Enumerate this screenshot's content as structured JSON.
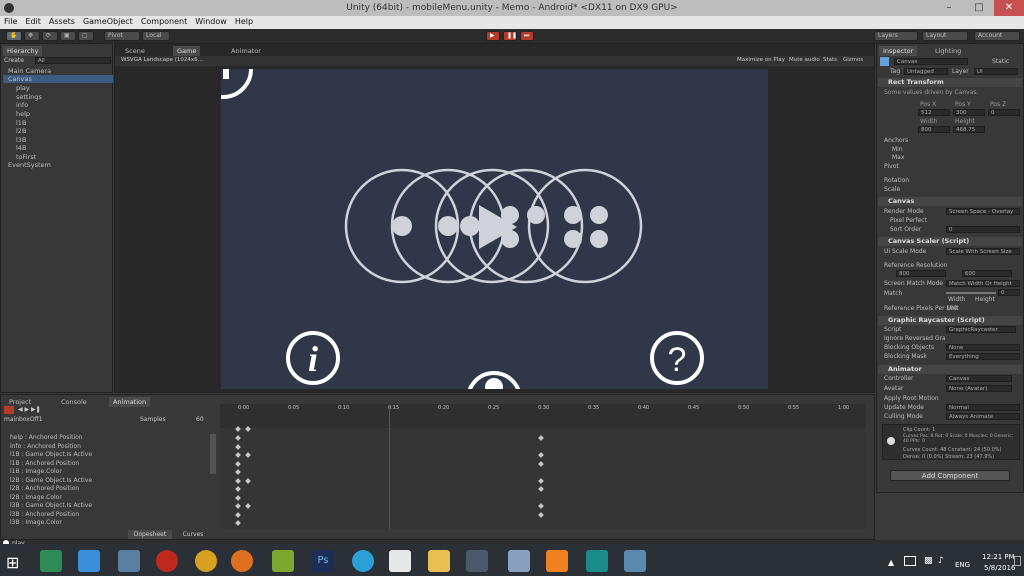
{
  "window": {
    "title": "Unity (64bit) - mobileMenu.unity - Memo - Android* <DX11 on DX9 GPU>"
  },
  "menu": [
    "File",
    "Edit",
    "Assets",
    "GameObject",
    "Component",
    "Window",
    "Help"
  ],
  "toolbar": {
    "pivot": "Pivot",
    "local": "Local",
    "layers": "Layers",
    "layout": "Layout",
    "account": "Account"
  },
  "hierarchy": {
    "tab": "Hierarchy",
    "create": "Create",
    "search": "All",
    "items": [
      "Main Camera",
      "Canvas",
      "play",
      "settings",
      "info",
      "help",
      "l1B",
      "l2B",
      "l3B",
      "l4B",
      "toFirst",
      "EventSystem"
    ]
  },
  "scene_tabs": {
    "scene": "Scene",
    "game": "Game",
    "animator": "Animator"
  },
  "game_toolbar": {
    "aspect": "WSVGA Landscape (1024x6...",
    "maximize": "Maximize on Play",
    "mute": "Mute audio",
    "stats": "Stats",
    "gizmos": "Gizmos"
  },
  "inspector": {
    "tab": "Inspector",
    "lighting": "Lighting",
    "object_name": "Canvas",
    "static": "Static",
    "tag_label": "Tag",
    "tag": "Untagged",
    "layer_label": "Layer",
    "layer": "UI",
    "rect_transform": "Rect Transform",
    "rect_note": "Some values driven by Canvas.",
    "pos_x": "Pos X",
    "pos_y": "Pos Y",
    "pos_z": "Pos Z",
    "pos_x_val": "512",
    "pos_y_val": "300",
    "pos_z_val": "0",
    "width": "Width",
    "height": "Height",
    "width_val": "800",
    "height_val": "468.75",
    "anchors": "Anchors",
    "min": "Min",
    "max": "Max",
    "pivot": "Pivot",
    "rotation": "Rotation",
    "scale": "Scale",
    "canvas": "Canvas",
    "render_mode": "Render Mode",
    "render_mode_val": "Screen Space - Overlay",
    "pixel_perfect": "Pixel Perfect",
    "sort_order": "Sort Order",
    "sort_order_val": "0",
    "canvas_scaler": "Canvas Scaler (Script)",
    "ui_scale_mode": "Ui Scale Mode",
    "ui_scale_mode_val": "Scale With Screen Size",
    "ref_res": "Reference Resolution",
    "ref_x": "800",
    "ref_y": "600",
    "screen_match": "Screen Match Mode",
    "screen_match_val": "Match Width Or Height",
    "match": "Match",
    "match_val": "0",
    "match_width": "Width",
    "match_height": "Height",
    "ref_ppu": "Reference Pixels Per Unit",
    "ref_ppu_val": "100",
    "raycaster": "Graphic Raycaster (Script)",
    "script": "Script",
    "script_val": "GraphicRaycaster",
    "ignore_reversed": "Ignore Reversed Gra",
    "blocking_objects": "Blocking Objects",
    "blocking_objects_val": "None",
    "blocking_mask": "Blocking Mask",
    "blocking_mask_val": "Everything",
    "animator": "Animator",
    "controller": "Controller",
    "controller_val": "Canvas",
    "avatar": "Avatar",
    "avatar_val": "None (Avatar)",
    "apply_root": "Apply Root Motion",
    "update_mode": "Update Mode",
    "update_mode_val": "Normal",
    "culling_mode": "Culling Mode",
    "culling_mode_val": "Always Animate",
    "info_lines": [
      "Clip Count: 1",
      "Curves Pos: 8 Rot: 0 Scale: 0 Muscles: 0 Generic: 40 PPtr: 0",
      "Curves Count: 48 Constant: 24 (50.0%)",
      "Dense: 0 (0.0%) Stream: 23 (47.9%)"
    ],
    "add_component": "Add Component"
  },
  "bottom_tabs": {
    "project": "Project",
    "console": "Console",
    "animation": "Animation"
  },
  "animation": {
    "clip": "mainboxOff1",
    "samples_label": "Samples",
    "samples": "60",
    "times": [
      "0:00",
      "0:05",
      "0:10",
      "0:15",
      "0:20",
      "0:25",
      "0:30",
      "0:35",
      "0:40",
      "0:45",
      "0:50",
      "0:55",
      "1:00"
    ],
    "tracks": [
      "help : Anchored Position",
      "info : Anchored Position",
      "l1B : Game Object.Is Active",
      "l1B : Anchored Position",
      "l1B : Image.Color",
      "l2B : Game Object.Is Active",
      "l2B : Anchored Position",
      "l2B : Image.Color",
      "l3B : Game Object.Is Active",
      "l3B : Anchored Position",
      "l3B : Image.Color"
    ],
    "dopesheet": "Dopesheet",
    "curves": "Curves"
  },
  "status": {
    "text": "play"
  },
  "taskbar": {
    "lang": "ENG",
    "time": "12:21 PM",
    "date": "5/8/2016"
  }
}
